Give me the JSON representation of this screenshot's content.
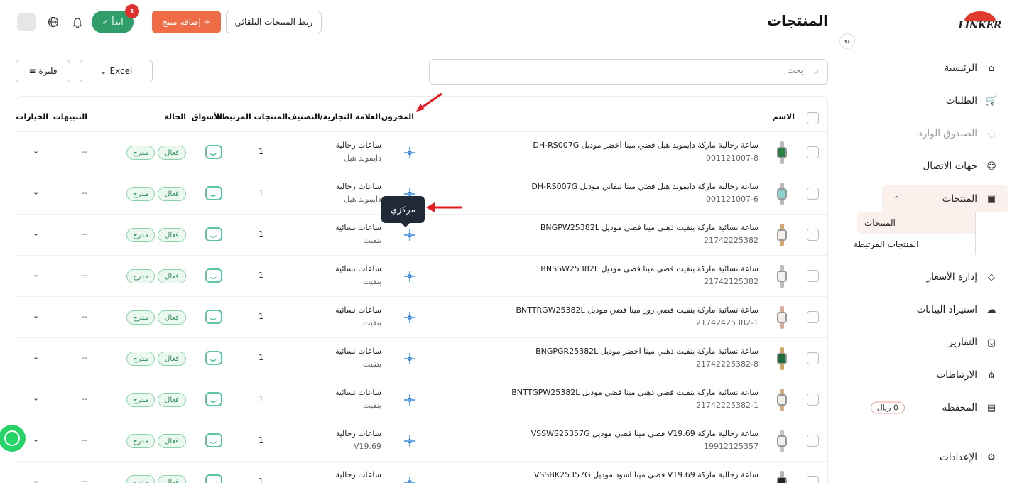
{
  "sidebar": {
    "logo": "LINKER",
    "collapse_glyph": "‹›",
    "items": [
      {
        "label": "الرئيسية",
        "icon": "home-icon",
        "glyph": "⌂",
        "chev": ""
      },
      {
        "label": "الطلبات",
        "icon": "cart-icon",
        "glyph": "🛒",
        "chev": "⌄"
      },
      {
        "label": "الصندوق الوارد",
        "icon": "chat-icon",
        "glyph": "◌",
        "chev": ""
      },
      {
        "label": "جهات الاتصال",
        "icon": "users-icon",
        "glyph": "☺",
        "chev": ""
      },
      {
        "label": "المنتجات",
        "icon": "archive-icon",
        "glyph": "▣",
        "chev": "⌃"
      },
      {
        "label": "إدارة الأسعار",
        "icon": "tag-icon",
        "glyph": "◇",
        "chev": ""
      },
      {
        "label": "استيراد البيانات",
        "icon": "upload-cloud-icon",
        "glyph": "☁",
        "chev": "⌄"
      },
      {
        "label": "التقارير",
        "icon": "clipboard-icon",
        "glyph": "▢",
        "chev": "⌄"
      },
      {
        "label": "الارتباطات",
        "icon": "share-icon",
        "glyph": "⋔",
        "chev": "⌄"
      },
      {
        "label": "المحفظة",
        "icon": "wallet-icon",
        "glyph": "▤",
        "chev": ""
      },
      {
        "label": "الإعدادات",
        "icon": "settings-icon",
        "glyph": "⚙",
        "chev": "⌄"
      }
    ],
    "sub_items": [
      "المنتجات",
      "المنتجات المرتبطة"
    ],
    "wallet_balance": "0 ريال"
  },
  "header": {
    "title": "المنتجات",
    "auto_link_button": "ربط المنتجات التلقائي",
    "add_product_button": "+ إضافة منتج",
    "start_button": "ابدأ ✓",
    "notification_count": "1"
  },
  "toolbar": {
    "search_placeholder": "بحث",
    "excel_button": "Excel ⌄",
    "filter_button": "فلترة ≡"
  },
  "table": {
    "headers": {
      "name": "الاسم",
      "stock": "المخزون",
      "brand_category": "العلامة التجارية/التصنيف",
      "linked": "المنتجات المرتبطة",
      "markets": "الأسواق",
      "status": "الحالة",
      "alerts": "التنبيهات",
      "options": "الخيارات"
    },
    "status_active": "فعال",
    "status_listed": "مدرج",
    "alerts_empty": "--",
    "options_glyph": "⌄",
    "rows": [
      {
        "name": "ساعة رجالية ماركة دايموند هيل فضي مينا اخضر موديل DH-RS007G",
        "sku": "001121007-8",
        "cat": "ساعات رجالية",
        "brand": "دايموند هيل",
        "linked": "1",
        "strap": "#b9b9b9",
        "face": "#2f7d46"
      },
      {
        "name": "ساعة رجالية ماركة دايموند هيل فضي مينا تيفاني موديل DH-RS007G",
        "sku": "001121007-6",
        "cat": "ساعات رجالية",
        "brand": "دايموند هيل",
        "linked": "1",
        "strap": "#b9b9b9",
        "face": "#8fd1d0"
      },
      {
        "name": "ساعة نسائية ماركة بنفيت ذهبي مينا فضي موديل BNGPW25382L",
        "sku": "21742225382",
        "cat": "ساعات نسائية",
        "brand": "بنفيت",
        "linked": "1",
        "strap": "#d7a66a",
        "face": "#f4efe8"
      },
      {
        "name": "ساعة نسائية ماركة بنفيت فضي مينا فضي موديل BNSSW25382L",
        "sku": "21742125382",
        "cat": "ساعات نسائية",
        "brand": "بنفيت",
        "linked": "1",
        "strap": "#bcbcbc",
        "face": "#f2f2f2"
      },
      {
        "name": "ساعة نسائية ماركة بنفيت فضي روز مينا فضي موديل BNTTRGW25382L",
        "sku": "21742425382-1",
        "cat": "ساعات نسائية",
        "brand": "بنفيت",
        "linked": "1",
        "strap": "#d9a99a",
        "face": "#f3ece9"
      },
      {
        "name": "ساعة نسائية ماركة بنفيت ذهبي مينا اخضر موديل BNGPGR25382L",
        "sku": "21742225382-8",
        "cat": "ساعات نسائية",
        "brand": "بنفيت",
        "linked": "1",
        "strap": "#cfa45f",
        "face": "#1f6b3c"
      },
      {
        "name": "ساعة نسائية ماركة بنفيت فضي ذهبي مينا فضي موديل BNTTGPW25382L",
        "sku": "21742225382-1",
        "cat": "ساعات نسائية",
        "brand": "بنفيت",
        "linked": "1",
        "strap": "#d2ad86",
        "face": "#f1ede7"
      },
      {
        "name": "ساعة رجالية ماركة V19.69 فضي مينا فضي موديل VSSWS25357G",
        "sku": "19912125357",
        "cat": "ساعات رجالية",
        "brand": "V19.69",
        "linked": "1",
        "strap": "#c4c4c4",
        "face": "#f0f0f0"
      },
      {
        "name": "ساعة رجالية ماركة V19.69 فضي مينا اسود موديل VSSBK25357G",
        "sku": "",
        "cat": "ساعات رجالية",
        "brand": "",
        "linked": "1",
        "strap": "#b5b5b5",
        "face": "#222"
      }
    ]
  },
  "tooltip": "مركزي",
  "colors": {
    "accent": "#ef6c47",
    "green": "#2f9e6b",
    "annotation": "#e31b23"
  }
}
